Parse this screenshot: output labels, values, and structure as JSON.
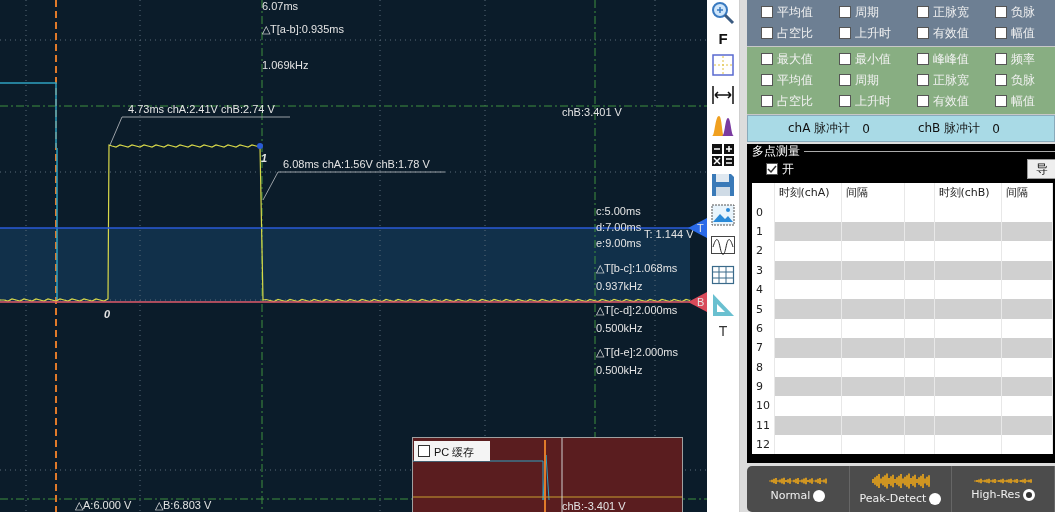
{
  "plot": {
    "top_readout": "6.07ms",
    "delta_ab": "△T[a-b]:0.935ms",
    "freq_ab": "1.069kHz",
    "point_markers": [
      "0",
      "1"
    ],
    "point_readouts": [
      "4.73ms chA:2.41V  chB:2.74 V",
      "6.08ms chA:1.56V  chB:1.78 V"
    ],
    "chb_level": "chB:3.401  V",
    "cursors": [
      "c:5.00ms",
      "d:7.00ms",
      "e:9.00ms"
    ],
    "trigger": {
      "marker": "T",
      "reading": "T: 1.144 V"
    },
    "channel_marker": "B",
    "deltas": [
      {
        "delta": "△T[b-c]:1.068ms",
        "freq": "0.937kHz"
      },
      {
        "delta": "△T[c-d]:2.000ms",
        "freq": "0.500kHz"
      },
      {
        "delta": "△T[d-e]:2.000ms",
        "freq": "0.500kHz"
      }
    ],
    "voltage_deltas": [
      "△A:6.000 V",
      "△B:6.803  V"
    ],
    "pc_cache": {
      "label": "PC 缓存",
      "checked": false,
      "reading": "chB:-3.401  V"
    }
  },
  "toolbar": {
    "labels": [
      "F",
      "T"
    ]
  },
  "measure_groups": [
    {
      "rows": [
        [
          {
            "label": "平均值",
            "checked": false
          },
          {
            "label": "周期",
            "checked": false
          },
          {
            "label": "正脉宽",
            "checked": false
          },
          {
            "label": "负脉",
            "checked": false
          }
        ],
        [
          {
            "label": "占空比",
            "checked": false
          },
          {
            "label": "上升时",
            "checked": false
          },
          {
            "label": "有效值",
            "checked": false
          },
          {
            "label": "幅值",
            "checked": false
          }
        ]
      ]
    },
    {
      "rows": [
        [
          {
            "label": "最大值",
            "checked": false
          },
          {
            "label": "最小值",
            "checked": false
          },
          {
            "label": "峰峰值",
            "checked": false
          },
          {
            "label": "频率",
            "checked": false
          }
        ],
        [
          {
            "label": "平均值",
            "checked": false
          },
          {
            "label": "周期",
            "checked": false
          },
          {
            "label": "正脉宽",
            "checked": false
          },
          {
            "label": "负脉",
            "checked": false
          }
        ],
        [
          {
            "label": "占空比",
            "checked": false
          },
          {
            "label": "上升时",
            "checked": false
          },
          {
            "label": "有效值",
            "checked": false
          },
          {
            "label": "幅值",
            "checked": false
          }
        ]
      ]
    }
  ],
  "pulse_counters": [
    {
      "label": "chA 脉冲计",
      "count": "0"
    },
    {
      "label": "chB 脉冲计",
      "count": "0"
    }
  ],
  "multi_point": {
    "title": "多点测量",
    "enable": {
      "label": "开",
      "checked": true
    },
    "button": "导",
    "columns": [
      "时刻(chA)",
      "间隔",
      "时刻(chB)",
      "间隔"
    ],
    "rows": [
      "0",
      "1",
      "2",
      "3",
      "4",
      "5",
      "6",
      "7",
      "8",
      "9",
      "10",
      "11",
      "12"
    ]
  },
  "acquisition_modes": [
    {
      "label": "Normal",
      "selected": false
    },
    {
      "label": "Peak-Detect",
      "selected": false
    },
    {
      "label": "High-Res",
      "selected": true
    }
  ]
}
